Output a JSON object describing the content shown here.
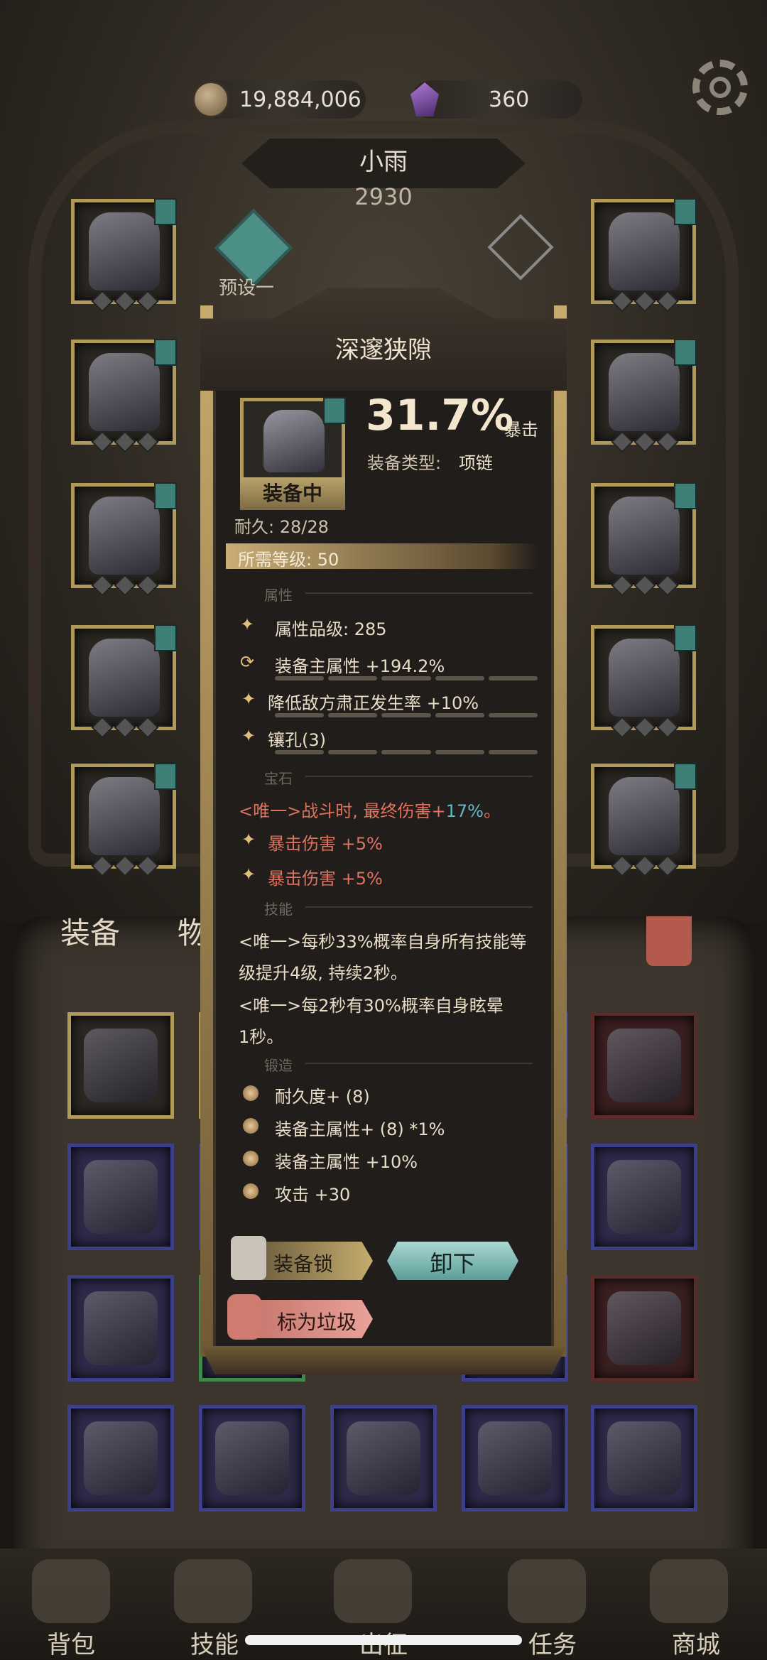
{
  "currency": {
    "coins": "19,884,006",
    "gems": "360"
  },
  "character": {
    "name": "小雨",
    "power": "2930",
    "preset": "预设一"
  },
  "bag_tabs": {
    "equip": "装备",
    "items": "物"
  },
  "popup": {
    "title": "深邃狭隙",
    "equipped_badge": "装备中",
    "main_stat_value": "31.7%",
    "main_stat_name": "暴击",
    "type_label": "装备类型:",
    "type_value": "项链",
    "durability": "耐久: 28/28",
    "required_level": "所需等级: 50",
    "sections": {
      "attributes": "属性",
      "gems": "宝石",
      "skills": "技能",
      "forge": "锻造"
    },
    "attributes": [
      "属性品级: 285",
      "装备主属性 +194.2%",
      "降低敌方肃正发生率 +10%",
      "镶孔(3)"
    ],
    "gem_unique_prefix": "<唯一>战斗时, 最终伤害+",
    "gem_unique_value": "17%",
    "gem_unique_suffix": "。",
    "gem_stats": [
      "暴击伤害 +5%",
      "暴击伤害 +5%"
    ],
    "skills_line1a": "<唯一>每秒33%概率自身所有技能等",
    "skills_line1b": "级提升4级, 持续2秒。",
    "skills_line2a": "<唯一>每2秒有30%概率自身眩晕",
    "skills_line2b": "1秒。",
    "forge": [
      "耐久度+ (8)",
      "装备主属性+ (8) *1%",
      "装备主属性 +10%",
      "攻击 +30"
    ],
    "lock_button": "装备锁",
    "unequip_button": "卸下",
    "trash_button": "标为垃圾"
  },
  "nav": [
    "背包",
    "技能",
    "出征",
    "任务",
    "商城"
  ],
  "colors": {
    "accent_gold": "#c9ad74",
    "teal": "#5fb8c9",
    "red_text": "#e0735f"
  },
  "icons": [
    "coin-icon",
    "gem-icon",
    "gear-icon",
    "lock-icon",
    "trash-icon"
  ]
}
